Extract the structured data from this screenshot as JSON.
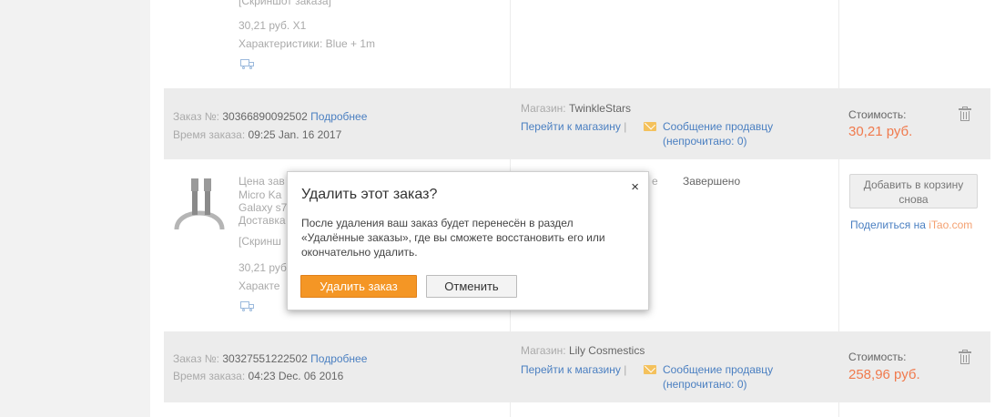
{
  "order_top": {
    "screenshot_label": "[Скриншот заказа]",
    "price_qty": "30,21 руб. X1",
    "characteristics": "Характеристики: Blue + 1m"
  },
  "order1": {
    "order_no_label": "Заказ №:",
    "order_no": "30366890092502",
    "details_link": "Подробнее",
    "time_label": "Время заказа:",
    "time": "09:25 Jan. 16 2017",
    "store_label": "Магазин:",
    "store": "TwinkleStars",
    "go_to_store": "Перейти к магазину",
    "separator": "|",
    "message_seller": "Сообщение продавцу",
    "unread_prefix": "(непрочитано: ",
    "unread_count": "0",
    "unread_suffix": ")",
    "cost_label": "Стоимость:",
    "cost": "30,21 руб."
  },
  "order1_item": {
    "line1": "Цена зав",
    "line2": "Micro Ka",
    "line3": "Galaxy s7",
    "line4": "Доставка",
    "line5": "[Скринш",
    "price_qty": "30,21 руб.",
    "characteristics": "Характе",
    "status_partial": "е",
    "status": "Завершено",
    "add_to_cart": "Добавить в корзину снова",
    "share_prefix": "Поделиться на ",
    "share_site": "iTao.com"
  },
  "order2": {
    "order_no_label": "Заказ №:",
    "order_no": "30327551222502",
    "details_link": "Подробнее",
    "time_label": "Время заказа:",
    "time": "04:23 Dec. 06 2016",
    "store_label": "Магазин:",
    "store": "Lily Cosmestics",
    "go_to_store": "Перейти к магазину",
    "separator": "|",
    "message_seller": "Сообщение продавцу",
    "unread_prefix": "(непрочитано: ",
    "unread_count": "0",
    "unread_suffix": ")",
    "cost_label": "Стоимость:",
    "cost": "258,96 руб."
  },
  "dialog": {
    "title": "Удалить этот заказ?",
    "close": "×",
    "body": "После удаления ваш заказ будет перенесён в раздел «Удалённые заказы», где вы сможете восстановить его или окончательно удалить.",
    "confirm": "Удалить заказ",
    "cancel": "Отменить"
  },
  "colors": {
    "accent": "#f49625",
    "link": "#4a7fc1",
    "price": "#f07a4d"
  }
}
